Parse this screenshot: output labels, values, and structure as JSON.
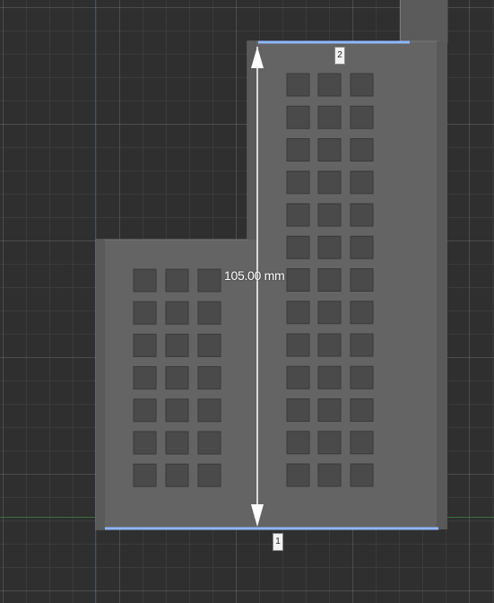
{
  "viewport": {
    "dimension_label": "105.00 mm",
    "point_labels": [
      "1",
      "2"
    ]
  },
  "colors": {
    "background": "#2f2f2f",
    "model_face": "#646464",
    "selection_edge": "#8fb6ff",
    "x_axis": "#3c6e3c"
  },
  "icons": [
    "dimension-arrow-up-icon",
    "dimension-arrow-down-icon"
  ]
}
